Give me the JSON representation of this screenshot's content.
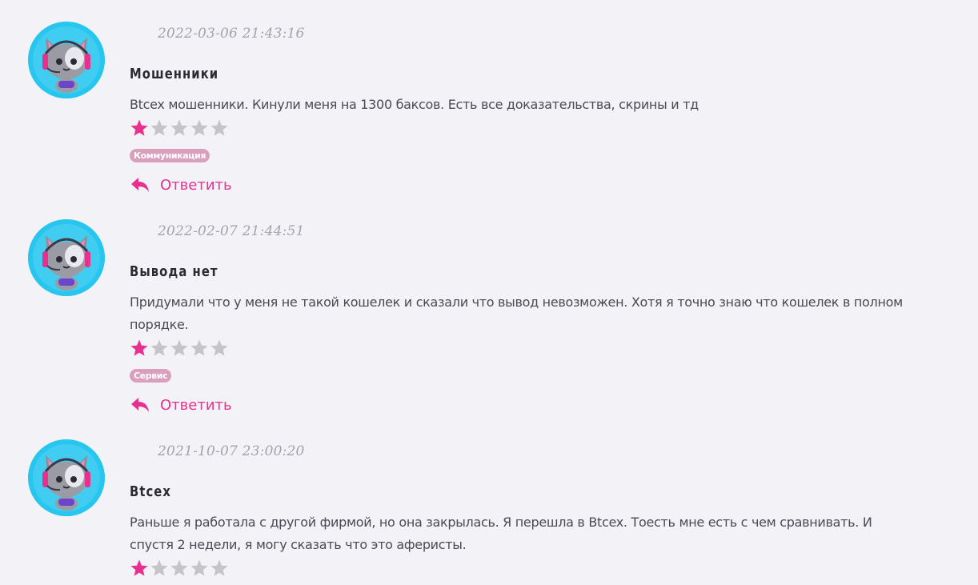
{
  "colors": {
    "accent": "#e8318f",
    "star_empty": "#c4c4c9",
    "tag_bg": "#d99fbd",
    "avatar_bg": "#27c6ef"
  },
  "reply_label": "Ответить",
  "reviews": [
    {
      "date": "2022-03-06 21:43:16",
      "title": "Мошенники",
      "text": "Btcex мошенники. Кинули меня на 1300 баксов. Есть все доказательства, скрины и тд",
      "rating": 1,
      "tag": "Коммуникация"
    },
    {
      "date": "2022-02-07 21:44:51",
      "title": "Вывода нет",
      "text": "Придумали что у меня не такой кошелек и сказали что вывод невозможен. Хотя я точно знаю что кошелек в полном порядке.",
      "rating": 1,
      "tag": "Сервис"
    },
    {
      "date": "2021-10-07 23:00:20",
      "title": "Btcex",
      "text": "Раньше я работала с другой фирмой, но она закрылась. Я перешла в Btcex. Тоесть мне есть с чем сравнивать. И спустя 2 недели, я могу сказать что это аферисты.",
      "rating": 1
    }
  ]
}
